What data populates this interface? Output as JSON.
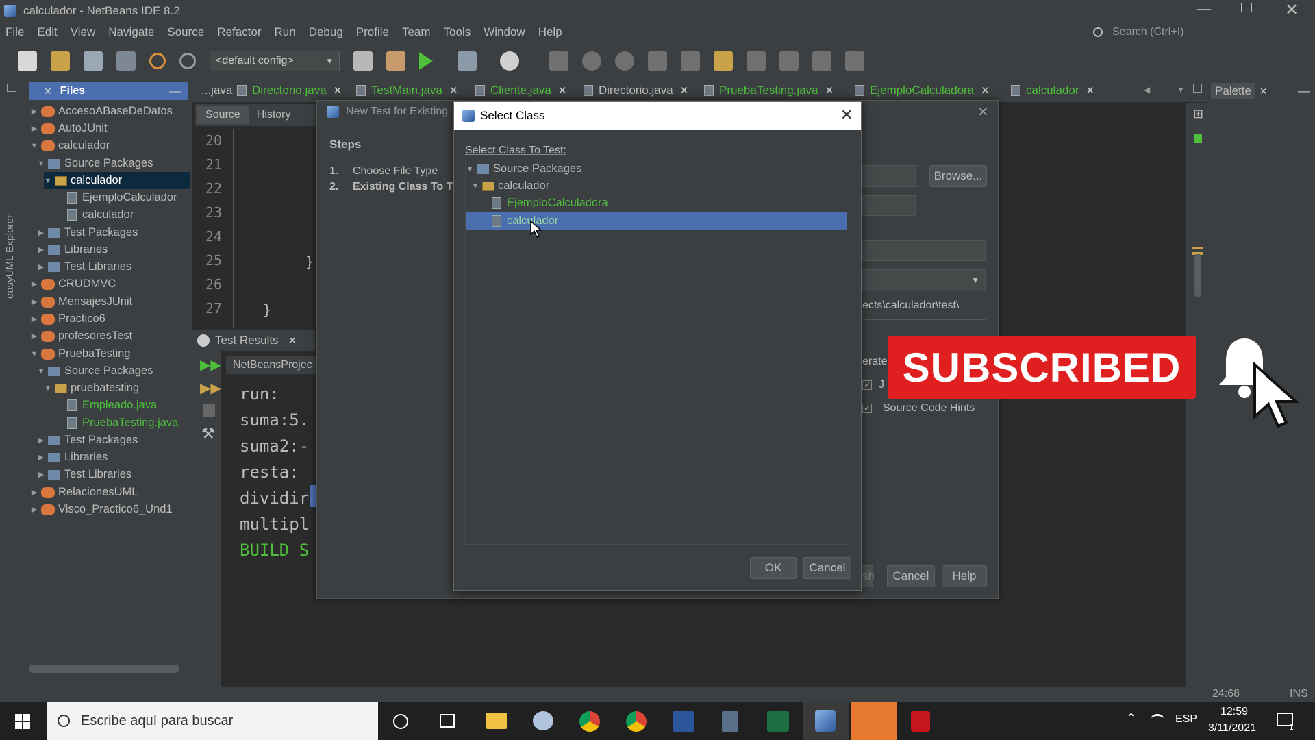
{
  "window": {
    "title": "calculador - NetBeans IDE 8.2"
  },
  "menu": [
    "File",
    "Edit",
    "View",
    "Navigate",
    "Source",
    "Refactor",
    "Run",
    "Debug",
    "Profile",
    "Team",
    "Tools",
    "Window",
    "Help"
  ],
  "search": {
    "placeholder": "Search (Ctrl+I)"
  },
  "toolbar": {
    "config": "<default config>"
  },
  "sidebar": {
    "vertical_label": "easyUML Explorer",
    "panel_title": "Files"
  },
  "tree": [
    {
      "label": "AccesoABaseDeDatos"
    },
    {
      "label": "AutoJUnit"
    },
    {
      "label": "calculador"
    },
    {
      "label": "Source Packages"
    },
    {
      "label": "calculador"
    },
    {
      "label": "EjemploCalculador"
    },
    {
      "label": "calculador"
    },
    {
      "label": "Test Packages"
    },
    {
      "label": "Libraries"
    },
    {
      "label": "Test Libraries"
    },
    {
      "label": "CRUDMVC"
    },
    {
      "label": "MensajesJUnit"
    },
    {
      "label": "Practico6"
    },
    {
      "label": "profesoresTest"
    },
    {
      "label": "PruebaTesting"
    },
    {
      "label": "Source Packages"
    },
    {
      "label": "pruebatesting"
    },
    {
      "label": "Empleado.java"
    },
    {
      "label": "PruebaTesting.java"
    },
    {
      "label": "Test Packages"
    },
    {
      "label": "Libraries"
    },
    {
      "label": "Test Libraries"
    },
    {
      "label": "RelacionesUML"
    },
    {
      "label": "Visco_Practico6_Und1"
    }
  ],
  "editor_tabs": [
    "...java",
    "Directorio.java",
    "TestMain.java",
    "Cliente.java",
    "Directorio.java",
    "PruebaTesting.java",
    "EjemploCalculadora",
    "calculador"
  ],
  "editor": {
    "source_tab": "Source",
    "history_tab": "History",
    "line_numbers": [
      "20",
      "21",
      "22",
      "23",
      "24",
      "25",
      "26",
      "27"
    ],
    "brace1": "}",
    "brace2": "}"
  },
  "palette": {
    "title": "Palette"
  },
  "test_results": {
    "title": "Test Results",
    "project": "NetBeansProjec",
    "lines": [
      "run:",
      "suma:5.",
      "suma2:-",
      "resta:",
      "dividir",
      "multipl",
      "BUILD S"
    ]
  },
  "wizard": {
    "title": "New Test for Existing",
    "steps_title": "Steps",
    "steps": [
      {
        "num": "1.",
        "label": "Choose File Type"
      },
      {
        "num": "2.",
        "label": "Existing Class To T"
      }
    ],
    "browse": "Browse...",
    "path": "ects\\calculador\\test\\",
    "generate": "erate",
    "check1": "J",
    "check2": "Source Code Hints",
    "finish": "sh",
    "cancel": "Cancel",
    "help": "Help"
  },
  "select_class": {
    "title": "Select Class",
    "prompt": "Select Class To Test:",
    "nodes": [
      {
        "label": "Source Packages"
      },
      {
        "label": "calculador"
      },
      {
        "label": "EjemploCalculadora"
      },
      {
        "label": "calculador"
      }
    ],
    "ok": "OK",
    "cancel": "Cancel"
  },
  "overlay": {
    "subscribed": "SUBSCRIBED"
  },
  "status": {
    "position": "24:68",
    "mode": "INS"
  },
  "taskbar": {
    "search_placeholder": "Escribe aquí para buscar",
    "lang": "ESP",
    "time": "12:59",
    "date": "3/11/2021",
    "notif_count": "1"
  },
  "colors": {
    "ide_bg": "#3c3f41",
    "editor_bg": "#2b2b2b",
    "selection": "#4b6eaf",
    "subscribed_red": "#e02020",
    "green_text": "#4ec03c"
  }
}
